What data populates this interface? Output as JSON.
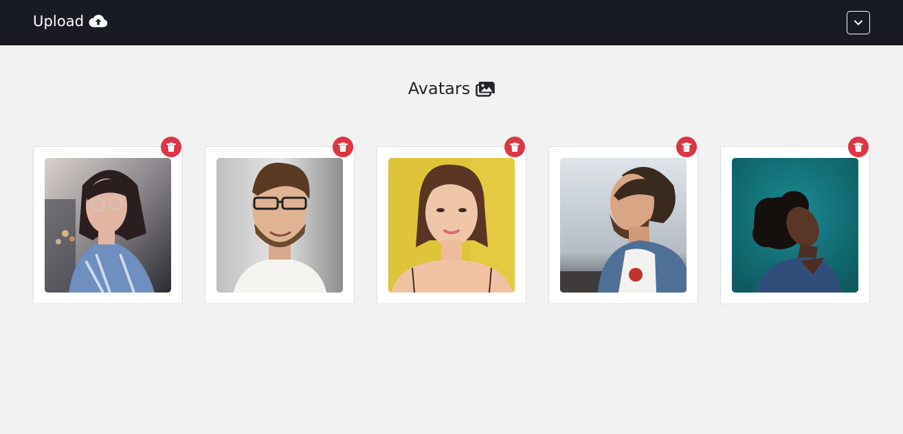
{
  "navbar": {
    "brand_label": "Upload",
    "brand_icon": "cloud-upload-icon",
    "toggler_icon": "chevron-down-icon"
  },
  "page": {
    "title": "Avatars",
    "title_icon": "images-icon"
  },
  "avatars": [
    {
      "alt": "avatar-1",
      "delete_icon": "trash-icon"
    },
    {
      "alt": "avatar-2",
      "delete_icon": "trash-icon"
    },
    {
      "alt": "avatar-3",
      "delete_icon": "trash-icon"
    },
    {
      "alt": "avatar-4",
      "delete_icon": "trash-icon"
    },
    {
      "alt": "avatar-5",
      "delete_icon": "trash-icon"
    }
  ],
  "colors": {
    "navbar_bg": "#181b24",
    "page_bg": "#f2f2f2",
    "danger": "#dc3545",
    "card_bg": "#ffffff"
  }
}
